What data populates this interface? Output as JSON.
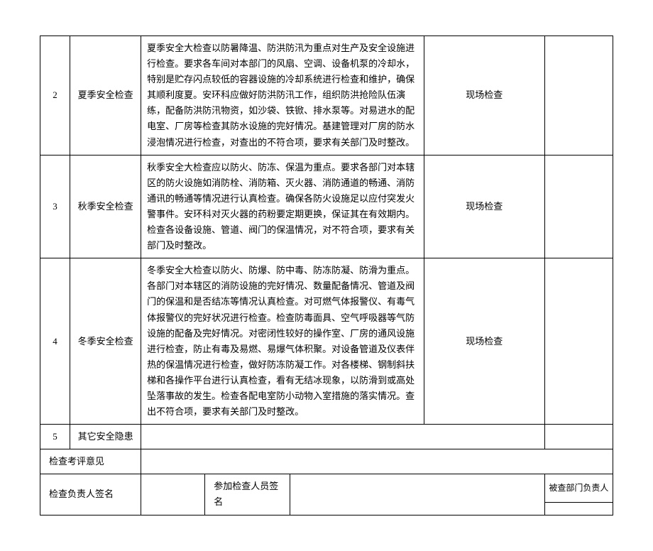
{
  "rows": [
    {
      "num": "2",
      "name": "夏季安全检查",
      "content": "夏季安全大检查以防暑降温、防洪防汛为重点对生产及安全设施进行检查。要求各车间对本部门的风扇、空调、设备机泵的冷却水，特别是贮存闪点较低的容器设施的冷却系统进行检查和维护，确保其顺利度夏。安环科应做好防洪防汛工作，组织防洪抢险队伍演练，配备防洪防汛物资，如沙袋、铁锨、排水泵等。对易进水的配电室、厂房等检查其防水设施的完好情况。基建管理对厂房的防水浸泡情况进行检查，对查出的不符合项，要求有关部门及时整改。",
      "method": "现场检查"
    },
    {
      "num": "3",
      "name": "秋季安全检查",
      "content": "秋季安全大检查应以防火、防冻、保温为重点。要求各部门对本辖区的防火设施如消防栓、消防箱、灭火器、消防通道的畅通、消防通讯的畅通等情况进行认真检查。确保各防火设施足以应付突发火警事件。安环科对灭火器的药粉要定期更换，保证其在有效期内。检查各设备设施、管道、阀门的保温情况，对不符合项，要求有关部门及时整改。",
      "method": "现场检查"
    },
    {
      "num": "4",
      "name": "冬季安全检查",
      "content": "冬季安全大检查以防火、防爆、防中毒、防冻防凝、防滑为重点。各部门对本辖区的消防设施的完好情况、数量配备情况、管道及阀门的保温和是否结冻等情况认真检查。对可燃气体报警仪、有毒气体报警仪的完好状况进行检查。检查防毒面具、空气呼吸器等气防设施的配备及完好情况。对密闭性较好的操作室、厂房的通风设施进行检查，防止有毒及易燃、易爆气体积聚。对设备管道及仪表伴热的保温情况进行检查，做好防冻防凝工作。对各楼梯、钢制斜扶梯和各操作平台进行认真检查，看有无结冰现象，以防滑到或高处坠落事故的发生。检查各配电室防小动物入室措施的落实情况。查出不符合项，要求有关部门及时整改。",
      "method": "现场检查"
    },
    {
      "num": "5",
      "name": "其它安全隐患",
      "content": "",
      "method": ""
    }
  ],
  "labels": {
    "opinion": "检查考评意见",
    "leaderSign": "检查负责人签名",
    "participantSign": "参加检查人员签名",
    "deptLeaderSign": "被查部门负责人"
  }
}
